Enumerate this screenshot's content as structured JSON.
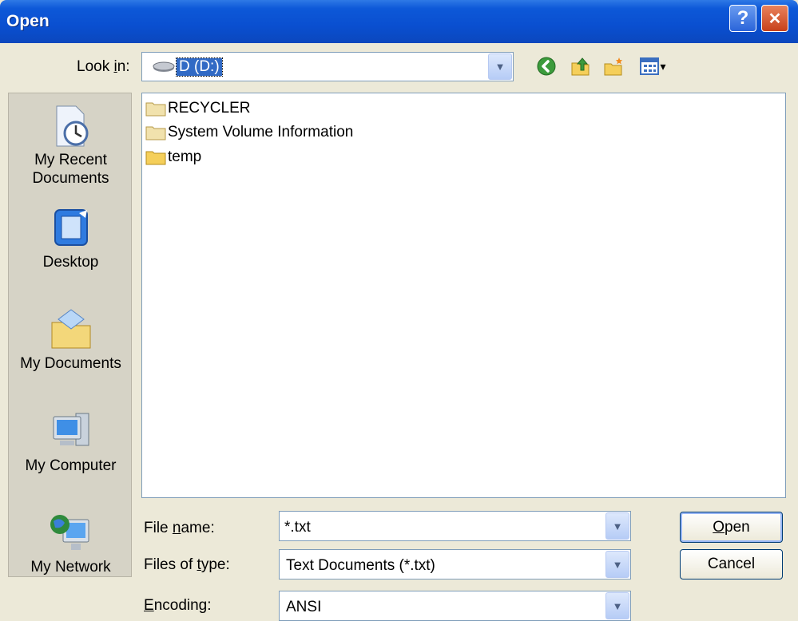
{
  "window": {
    "title": "Open",
    "help_glyph": "?",
    "close_glyph": "✕"
  },
  "look_in": {
    "label_pre": "Look ",
    "label_key": "i",
    "label_post": "n:",
    "value": "D (D:)",
    "icon": "drive-icon"
  },
  "toolbar": {
    "back_icon": "back-icon",
    "up_icon": "up-folder-icon",
    "new_folder_icon": "new-folder-icon",
    "views_icon": "views-menu-icon",
    "views_arrow": "▾"
  },
  "places": [
    {
      "line1": "My Recent",
      "line2": "Documents",
      "icon": "recent-documents-icon"
    },
    {
      "line1": "Desktop",
      "line2": "",
      "icon": "desktop-icon"
    },
    {
      "line1": "My Documents",
      "line2": "",
      "icon": "my-documents-icon"
    },
    {
      "line1": "My Computer",
      "line2": "",
      "icon": "my-computer-icon"
    },
    {
      "line1": "My Network",
      "line2": "",
      "icon": "my-network-icon"
    }
  ],
  "files": [
    {
      "name": "RECYCLER",
      "icon": "folder-icon"
    },
    {
      "name": "System Volume Information",
      "icon": "folder-icon"
    },
    {
      "name": "temp",
      "icon": "folder-icon"
    }
  ],
  "file_name": {
    "label_pre": "File ",
    "label_key": "n",
    "label_post": "ame:",
    "value": "*.txt"
  },
  "file_type": {
    "label_pre": "Files of ",
    "label_key": "t",
    "label_post": "ype:",
    "value": "Text Documents (*.txt)"
  },
  "encoding": {
    "label_pre": "",
    "label_key": "E",
    "label_post": "ncoding:",
    "value": "ANSI"
  },
  "buttons": {
    "open_key": "O",
    "open_rest": "pen",
    "cancel": "Cancel"
  },
  "colors": {
    "title_blue": "#0a4fd0",
    "selection": "#316ac5",
    "face": "#ece9d8"
  }
}
